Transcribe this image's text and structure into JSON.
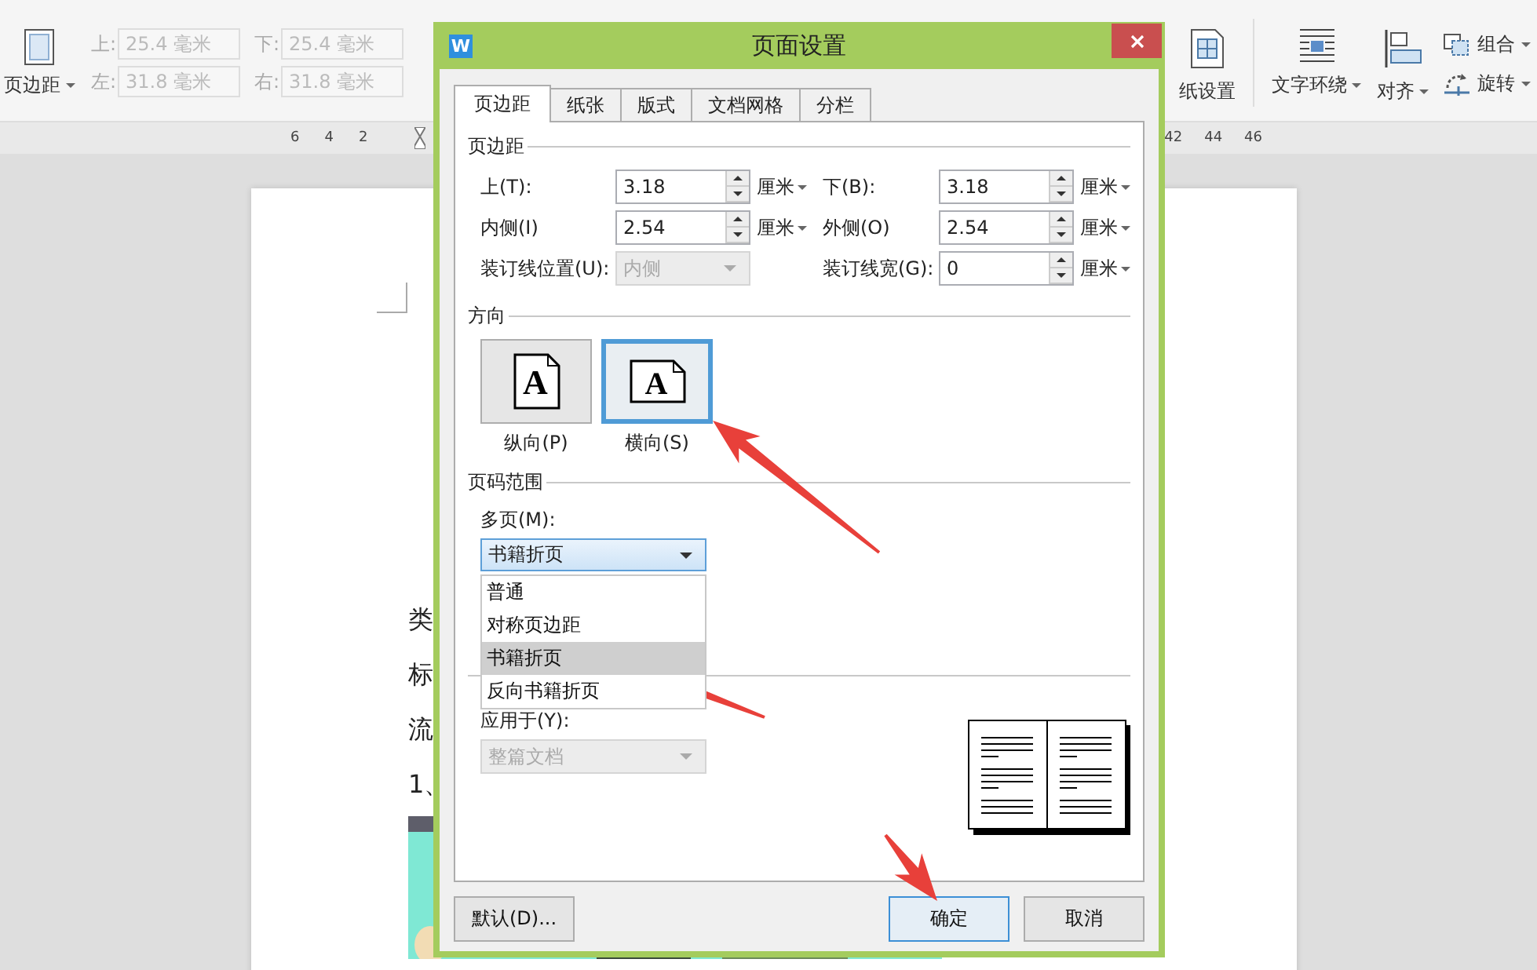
{
  "toolbar": {
    "margin_button": {
      "label": "页边距"
    },
    "margin_fields": [
      {
        "label": "上:",
        "value": "25.4 毫米",
        "disabled": true
      },
      {
        "label": "下:",
        "value": "25.4 毫米",
        "disabled": true
      },
      {
        "label": "左:",
        "value": "31.8 毫米",
        "disabled": true
      },
      {
        "label": "右:",
        "value": "31.8 毫米",
        "disabled": true
      }
    ],
    "items": [
      {
        "label": "纸设置",
        "kind": "large",
        "dropdown": false
      },
      {
        "label": "文字环绕",
        "kind": "large",
        "dropdown": true
      },
      {
        "label": "对齐",
        "kind": "large",
        "dropdown": true
      },
      {
        "label": "组合",
        "kind": "small",
        "dropdown": true
      },
      {
        "label": "旋转",
        "kind": "small",
        "dropdown": true
      }
    ]
  },
  "ruler": {
    "left_numbers": [
      "6",
      "4",
      "2"
    ],
    "right_numbers": [
      "42",
      "44",
      "46"
    ]
  },
  "document": {
    "lines": [
      "类",
      "标",
      "流",
      "1、"
    ]
  },
  "dialog": {
    "logo_text": "W",
    "title": "页面设置",
    "tabs": [
      {
        "label": "页边距",
        "selected": true
      },
      {
        "label": "纸张",
        "selected": false
      },
      {
        "label": "版式",
        "selected": false
      },
      {
        "label": "文档网格",
        "selected": false
      },
      {
        "label": "分栏",
        "selected": false
      }
    ],
    "margins": {
      "heading": "页边距",
      "fields": [
        {
          "label": "上(T):",
          "kind": "spin",
          "value": "3.18",
          "unit": "厘米",
          "disabled": false
        },
        {
          "label": "下(B):",
          "kind": "spin",
          "value": "3.18",
          "unit": "厘米",
          "disabled": false
        },
        {
          "label": "内侧(I)",
          "kind": "spin",
          "value": "2.54",
          "unit": "厘米",
          "disabled": false
        },
        {
          "label": "外侧(O)",
          "kind": "spin",
          "value": "2.54",
          "unit": "厘米",
          "disabled": false
        },
        {
          "label": "装订线位置(U):",
          "kind": "select",
          "value": "内侧",
          "disabled": true
        },
        {
          "label": "装订线宽(G):",
          "kind": "spin",
          "value": "0",
          "unit": "厘米",
          "disabled": false
        }
      ]
    },
    "orientation": {
      "heading": "方向",
      "options": [
        {
          "label": "纵向(P)",
          "glyph": "A",
          "selected": false
        },
        {
          "label": "横向(S)",
          "glyph": "A",
          "selected": true
        }
      ]
    },
    "pages": {
      "heading": "页码范围",
      "label": "多页(M):",
      "value": "书籍折页",
      "open": true,
      "options": [
        {
          "label": "普通",
          "selected": false
        },
        {
          "label": "对称页边距",
          "selected": false
        },
        {
          "label": "书籍折页",
          "selected": true
        },
        {
          "label": "反向书籍折页",
          "selected": false
        }
      ]
    },
    "preview": {
      "apply_label": "应用于(Y):",
      "apply_value": "整篇文档",
      "apply_disabled": true
    },
    "buttons": [
      {
        "label": "默认(D)...",
        "default": false
      },
      {
        "label": "确定",
        "default": true
      },
      {
        "label": "取消",
        "default": false
      }
    ]
  }
}
